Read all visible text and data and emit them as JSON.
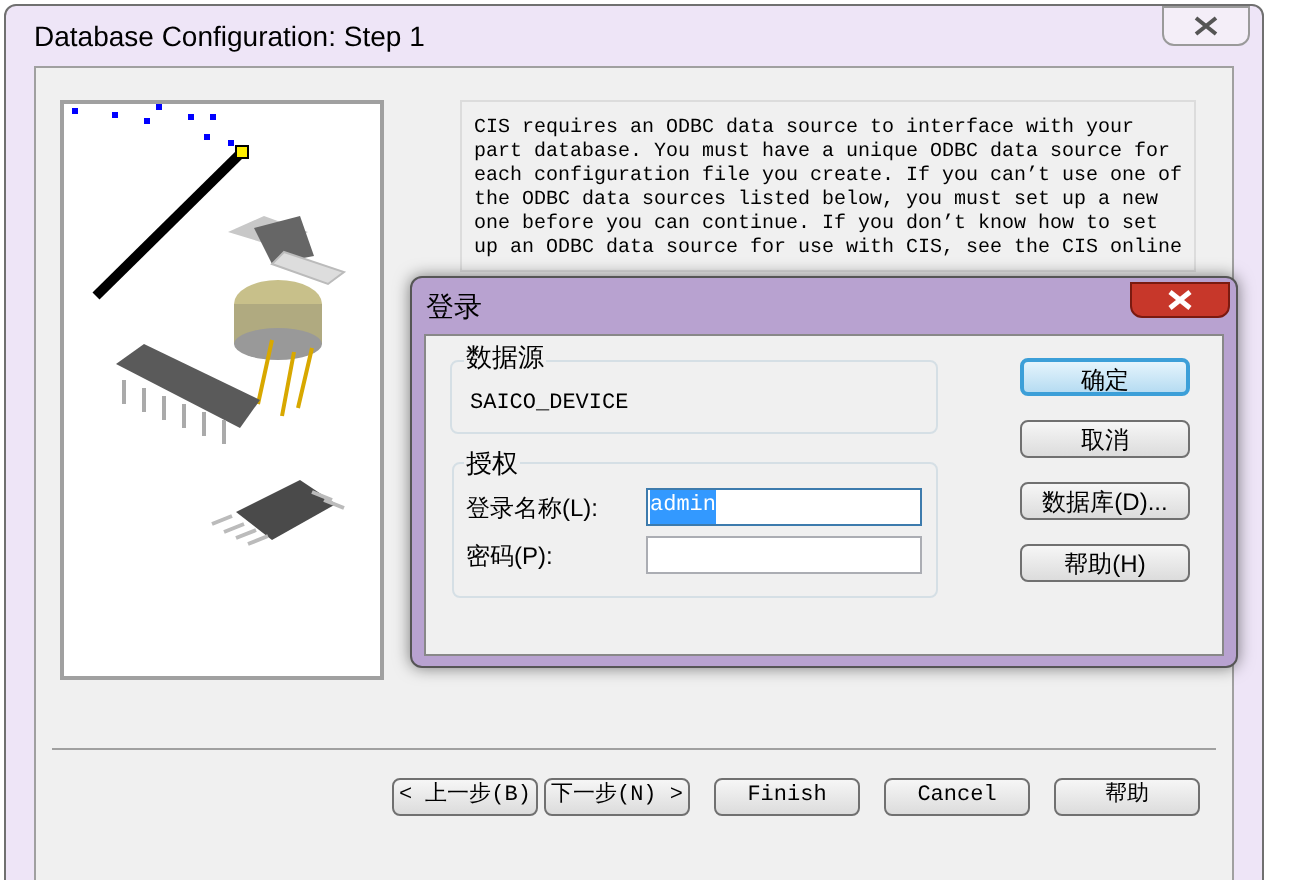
{
  "window": {
    "title": "Database Configuration: Step 1"
  },
  "description": [
    "CIS requires an ODBC data source to interface with your",
    "part database. You must have a unique ODBC data source for",
    "each configuration file you create. If you can’t use one of",
    "the ODBC data sources listed below, you must set up a new",
    "one before you can continue. If you don’t know how to set",
    "up an ODBC data source for use with CIS, see the CIS online"
  ],
  "buttons": [
    {
      "label": "< 上一步(B)",
      "kind": "nav"
    },
    {
      "label": "下一步(N) >",
      "kind": "nav"
    },
    {
      "label": "Finish",
      "kind": "normal"
    },
    {
      "label": "Cancel",
      "kind": "normal"
    },
    {
      "label": "帮助",
      "kind": "normal"
    }
  ],
  "login_dialog": {
    "title": "登录",
    "data_source": {
      "label": "数据源",
      "value": "SAICO_DEVICE"
    },
    "auth": {
      "label": "授权",
      "fields": [
        {
          "label": "登录名称(L):",
          "value": "admin",
          "selected": true
        },
        {
          "label": "密码(P):",
          "selected": false
        }
      ]
    },
    "buttons": [
      {
        "label": "确定",
        "default": true
      },
      {
        "label": "取消",
        "default": false
      },
      {
        "label": "数据库(D)...",
        "default": false
      },
      {
        "label": "帮助(H)",
        "default": false
      }
    ]
  }
}
